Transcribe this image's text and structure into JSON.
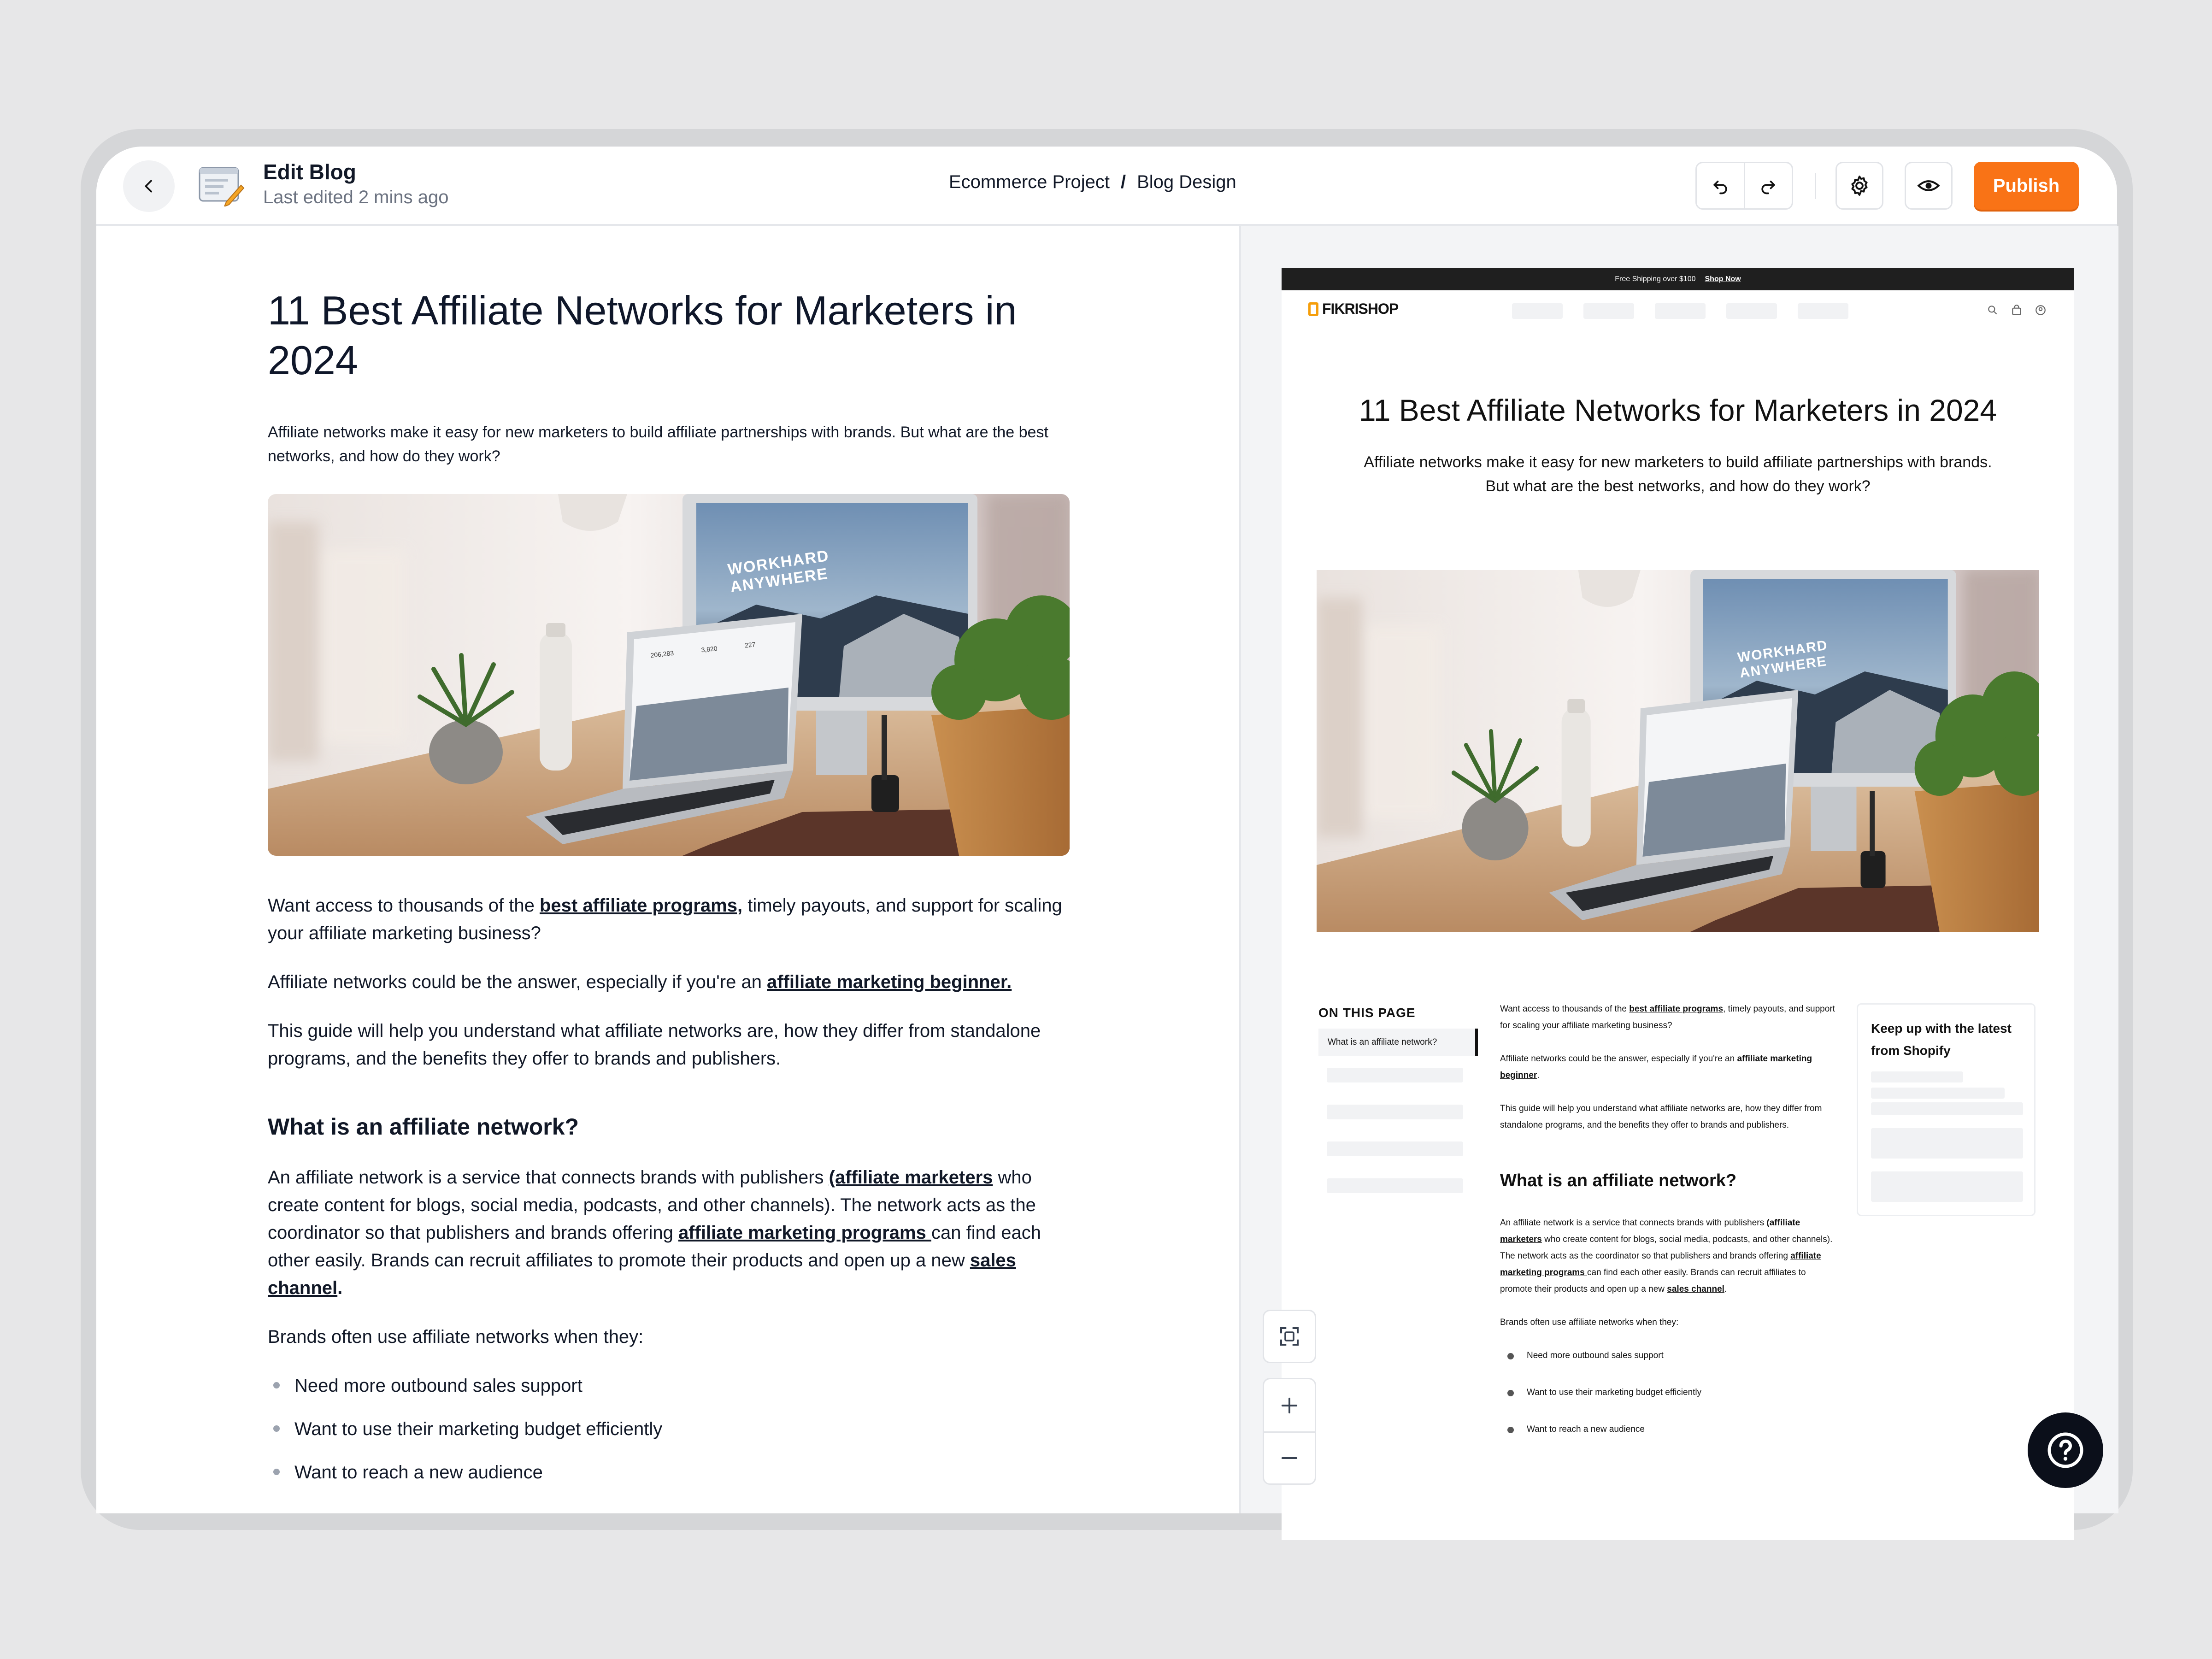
{
  "header": {
    "title": "Edit Blog",
    "subtitle": "Last edited 2 mins ago",
    "breadcrumb": {
      "project": "Ecommerce Project",
      "separator": "/",
      "page": "Blog Design"
    },
    "publish_label": "Publish",
    "colors": {
      "publish": "#f97316"
    }
  },
  "editor": {
    "title": "11 Best Affiliate Networks for Marketers in 2024",
    "lead": "Affiliate networks make it easy for new marketers to build affiliate partnerships with brands. But what are the best networks, and how do they work?",
    "p1_before": "Want access to thousands of the ",
    "p1_link": "best affiliate programs,",
    "p1_after": " timely payouts, and support for scaling your affiliate marketing business?",
    "p2_before": "Affiliate networks could be the answer, especially if you're an ",
    "p2_link": "affiliate marketing beginner.",
    "p3": "This guide will help you understand what affiliate networks are, how they differ from standalone programs, and the benefits they offer to brands and publishers.",
    "h2": "What is an affiliate network?",
    "p4_a": "An affiliate network is a service that connects brands with publishers ",
    "p4_link1": "(affiliate marketers",
    "p4_b": " who create content for blogs, social media, podcasts, and other channels). The network acts as the coordinator so that publishers and brands offering ",
    "p4_link2": "affiliate marketing programs ",
    "p4_c": "can find each other easily. Brands can recruit affiliates to promote their products and open up a new ",
    "p4_link3": "sales channel",
    "p4_d": ".",
    "p5": "Brands often use affiliate networks when they:",
    "bullets": [
      "Need more outbound sales support",
      "Want to use their marketing budget efficiently",
      "Want to reach a new audience"
    ]
  },
  "preview": {
    "promo_text": "Free Shipping over $100",
    "promo_link": "Shop Now",
    "logo": "FIKRISHOP",
    "title": "11 Best Affiliate Networks for Marketers in 2024",
    "lead": "Affiliate networks make it easy for new marketers to build affiliate partnerships with brands. But what are the best networks, and how do they work?",
    "toc_heading": "ON THIS PAGE",
    "toc_active": "What is an affiliate network?",
    "p1_before": "Want access to thousands of the ",
    "p1_link": "best affiliate programs",
    "p1_after": ", timely payouts, and support for scaling your affiliate marketing business?",
    "p2_before": "Affiliate networks could be the answer, especially if you're an ",
    "p2_link": "affiliate marketing beginner",
    "p2_after": ".",
    "p3": "This guide will help you understand what affiliate networks are, how they differ from standalone programs, and the benefits they offer to brands and publishers.",
    "h3": "What is an affiliate network?",
    "p4_a": "An affiliate network is a service that connects brands with publishers ",
    "p4_link1": "(affiliate marketers",
    "p4_b": " who create content for blogs, social media, podcasts, and other channels). The network acts as the coordinator so that publishers and brands offering ",
    "p4_link2": "affiliate marketing programs ",
    "p4_c": "can find each other easily. Brands can recruit affiliates to promote their products and open up a new ",
    "p4_link3": "sales channel",
    "p4_d": ".",
    "p5": "Brands often use affiliate networks when they:",
    "bullets": [
      "Need more outbound sales support",
      "Want to use their marketing budget efficiently",
      "Want to reach a new audience"
    ],
    "aside_title": "Keep up with the latest from Shopify"
  },
  "hero_image": {
    "screen_text_line1": "WORKHARD",
    "screen_text_line2": "ANYWHERE",
    "laptop_stat1": "206,283",
    "laptop_stat2": "3,820",
    "laptop_stat3": "227"
  },
  "icons": {
    "back": "chevron-left-icon",
    "doc": "document-edit-icon",
    "undo": "undo-icon",
    "redo": "redo-icon",
    "settings": "gear-icon",
    "preview": "eye-icon",
    "fit": "fit-screen-icon",
    "zoom_in": "plus-icon",
    "zoom_out": "minus-icon",
    "help": "question-icon"
  }
}
